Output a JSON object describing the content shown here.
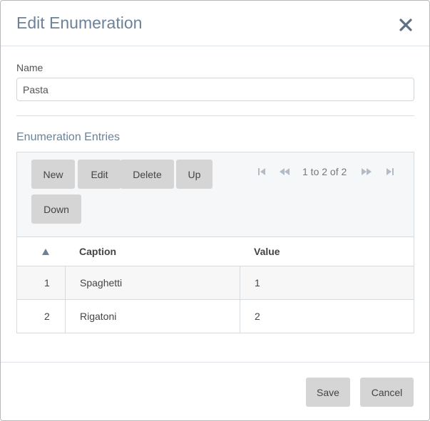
{
  "dialog": {
    "title": "Edit Enumeration",
    "close_icon": "close-icon"
  },
  "name_field": {
    "label": "Name",
    "value": "Pasta"
  },
  "entries": {
    "section_title": "Enumeration Entries",
    "toolbar": {
      "new_label": "New",
      "edit_label": "Edit",
      "delete_label": "Delete",
      "up_label": "Up",
      "down_label": "Down"
    },
    "pager": {
      "text": "1 to 2 of 2",
      "icons": [
        "first-page-icon",
        "prev-page-icon",
        "next-page-icon",
        "last-page-icon"
      ]
    },
    "columns": {
      "sort_icon": "sort-asc-icon",
      "caption": "Caption",
      "value": "Value"
    },
    "rows": [
      {
        "index": "1",
        "caption": "Spaghetti",
        "value": "1"
      },
      {
        "index": "2",
        "caption": "Rigatoni",
        "value": "2"
      }
    ]
  },
  "footer": {
    "save_label": "Save",
    "cancel_label": "Cancel"
  },
  "colors": {
    "title": "#6b8299",
    "button_bg": "#d5d5d5",
    "pager_icon": "#b3bcc5",
    "border": "#d6dbe0"
  }
}
